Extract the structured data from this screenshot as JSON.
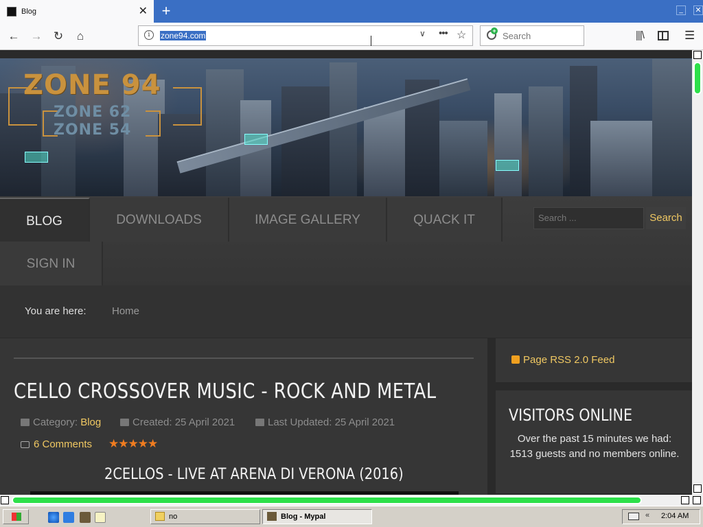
{
  "browser": {
    "tab_title": "Blog",
    "new_tab_symbol": "+",
    "tab_close_symbol": "✕",
    "url": "zone94.com",
    "search_placeholder": "Search",
    "icons": [
      "back-icon",
      "forward-icon",
      "reload-icon",
      "home-icon",
      "info-icon",
      "dropdown-icon",
      "more-icon",
      "bookmark-star-icon",
      "search-icon",
      "library-icon",
      "sidebar-icon",
      "menu-icon"
    ]
  },
  "site": {
    "logo_main": "ZONE 94",
    "logo_sub1": "ZONE 62",
    "logo_sub2": "ZONE 54",
    "nav": [
      "BLOG",
      "DOWNLOADS",
      "IMAGE GALLERY",
      "QUACK IT",
      "SIGN IN"
    ],
    "nav_active": "BLOG",
    "search_placeholder": "Search ...",
    "search_button": "Search",
    "breadcrumb_label": "You are here:",
    "breadcrumb_home": "Home",
    "accent_color": "#f0c862"
  },
  "article": {
    "title": "CELLO CROSSOVER MUSIC - ROCK AND METAL",
    "category_label": "Category:",
    "category": "Blog",
    "created": "Created: 25 April 2021",
    "updated": "Last Updated: 25 April 2021",
    "comments": "6 Comments",
    "rating_stars": 5,
    "stars_text": "★★★★★",
    "video_title": "2CELLOS - LIVE AT ARENA DI VERONA (2016)"
  },
  "sidebar": {
    "rss": "Page RSS 2.0 Feed",
    "visitors_title": "VISITORS ONLINE",
    "visitors_text": "Over the past 15 minutes we had: 1513 guests and no members online."
  },
  "taskbar": {
    "tasks": [
      "no",
      "Blog - Mypal"
    ],
    "active_task": "Blog - Mypal",
    "clock": "2:04 AM",
    "tray_chevron": "«"
  }
}
